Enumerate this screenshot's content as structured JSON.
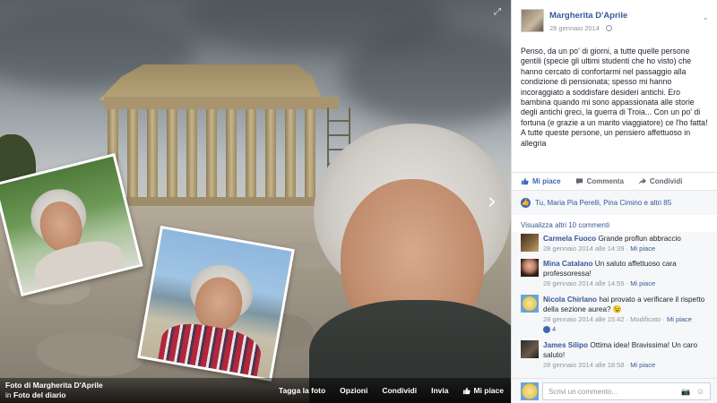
{
  "photo": {
    "expand_icon": "expand-icon",
    "next_icon": "chevron-right-icon",
    "caption_title": "Foto di Margherita D'Aprile",
    "caption_in": "in",
    "caption_album": "Foto del diario",
    "actions": {
      "tag": "Tagga la foto",
      "options": "Opzioni",
      "share": "Condividi",
      "send": "Invia",
      "like": "Mi piace"
    }
  },
  "post": {
    "author": "Margherita D'Aprile",
    "date": "28 gennaio 2014 ·",
    "text": "Penso, da un po' di giorni, a tutte quelle persone gentili (specie gli ultimi studenti che ho visto) che hanno cercato di confortarmi nel passaggio alla condizione di pensionata; spesso mi hanno incoraggiato a soddisfare desideri antichi. Ero bambina quando mi sono appassionata alle storie degli antichi greci, la guerra di Troia... Con un po' di fortuna (e grazie a un marito viaggiatore) ce l'ho fatta! A tutte queste persone, un pensiero affettuoso in allegria",
    "actions": {
      "like": "Mi piace",
      "comment": "Commenta",
      "share": "Condividi"
    },
    "likes_text": "Tu, Maria Pia Perelli, Pina Cimino e altri 85"
  },
  "comments": {
    "more_link": "Visualizza altri 10 commenti",
    "items": [
      {
        "name": "Carmela Fuoco",
        "text": "Grande proflun abbraccio",
        "meta": "28 gennaio 2014 alle 14:39 ·",
        "like": "Mi piace"
      },
      {
        "name": "Mina Catalano",
        "text": "Un saluto affettuoso cara professoressa!",
        "meta": "28 gennaio 2014 alle 14:55 ·",
        "like": "Mi piace"
      },
      {
        "name": "Nicola Chirlano",
        "text": "hai provato a verificare il rispetto della sezione aurea? 😉",
        "meta": "28 gennaio 2014 alle 15:42 · Modificato ·",
        "like": "Mi piace",
        "reactions": "4"
      },
      {
        "name": "James Silipo",
        "text": "Ottima idea! Bravissima! Un caro saluto!",
        "meta": "28 gennaio 2014 alle 18:58 ·",
        "like": "Mi piace"
      }
    ]
  },
  "composer": {
    "placeholder": "Scrivi un commento..."
  },
  "colors": {
    "link": "#365899",
    "brand": "#4267b2",
    "meta": "#90949c"
  }
}
